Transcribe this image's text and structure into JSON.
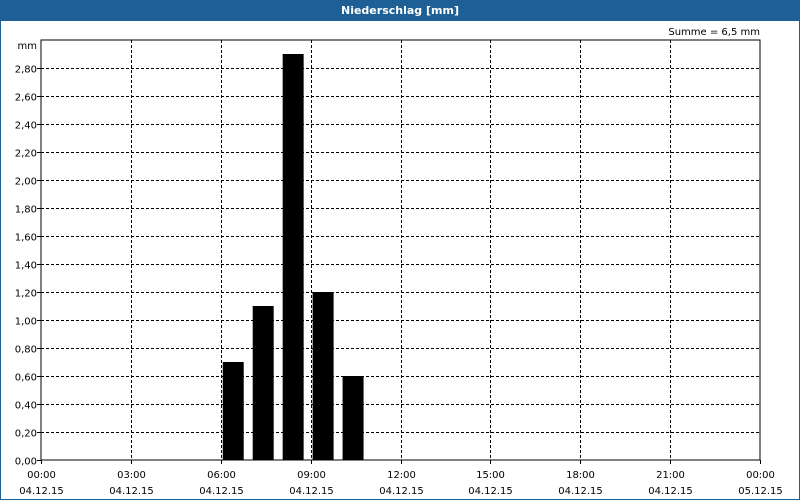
{
  "window": {
    "title": "Niederschlag [mm]"
  },
  "chart_data": {
    "type": "bar",
    "title": "Niederschlag [mm]",
    "ylabel": "mm",
    "annotation": "Summe = 6,5 mm",
    "ylim": [
      0,
      3.0
    ],
    "y_ticks": [
      "0,00",
      "0,20",
      "0,40",
      "0,60",
      "0,80",
      "1,00",
      "1,20",
      "1,40",
      "1,60",
      "1,80",
      "2,00",
      "2,20",
      "2,40",
      "2,60",
      "2,80"
    ],
    "y_tick_values": [
      0,
      0.2,
      0.4,
      0.6,
      0.8,
      1.0,
      1.2,
      1.4,
      1.6,
      1.8,
      2.0,
      2.2,
      2.4,
      2.6,
      2.8
    ],
    "x_range_hours": [
      0,
      24
    ],
    "x_ticks": [
      {
        "time": "00:00",
        "date": "04.12.15",
        "hour": 0
      },
      {
        "time": "03:00",
        "date": "04.12.15",
        "hour": 3
      },
      {
        "time": "06:00",
        "date": "04.12.15",
        "hour": 6
      },
      {
        "time": "09:00",
        "date": "04.12.15",
        "hour": 9
      },
      {
        "time": "12:00",
        "date": "04.12.15",
        "hour": 12
      },
      {
        "time": "15:00",
        "date": "04.12.15",
        "hour": 15
      },
      {
        "time": "18:00",
        "date": "04.12.15",
        "hour": 18
      },
      {
        "time": "21:00",
        "date": "04.12.15",
        "hour": 21
      },
      {
        "time": "00:00",
        "date": "05.12.15",
        "hour": 24
      }
    ],
    "bars": [
      {
        "hour": 6,
        "value": 0.7
      },
      {
        "hour": 7,
        "value": 1.1
      },
      {
        "hour": 8,
        "value": 2.9
      },
      {
        "hour": 9,
        "value": 1.2
      },
      {
        "hour": 10,
        "value": 0.6
      }
    ],
    "grid": true,
    "bar_color": "#000000",
    "frame_color": "#1e5f96"
  }
}
